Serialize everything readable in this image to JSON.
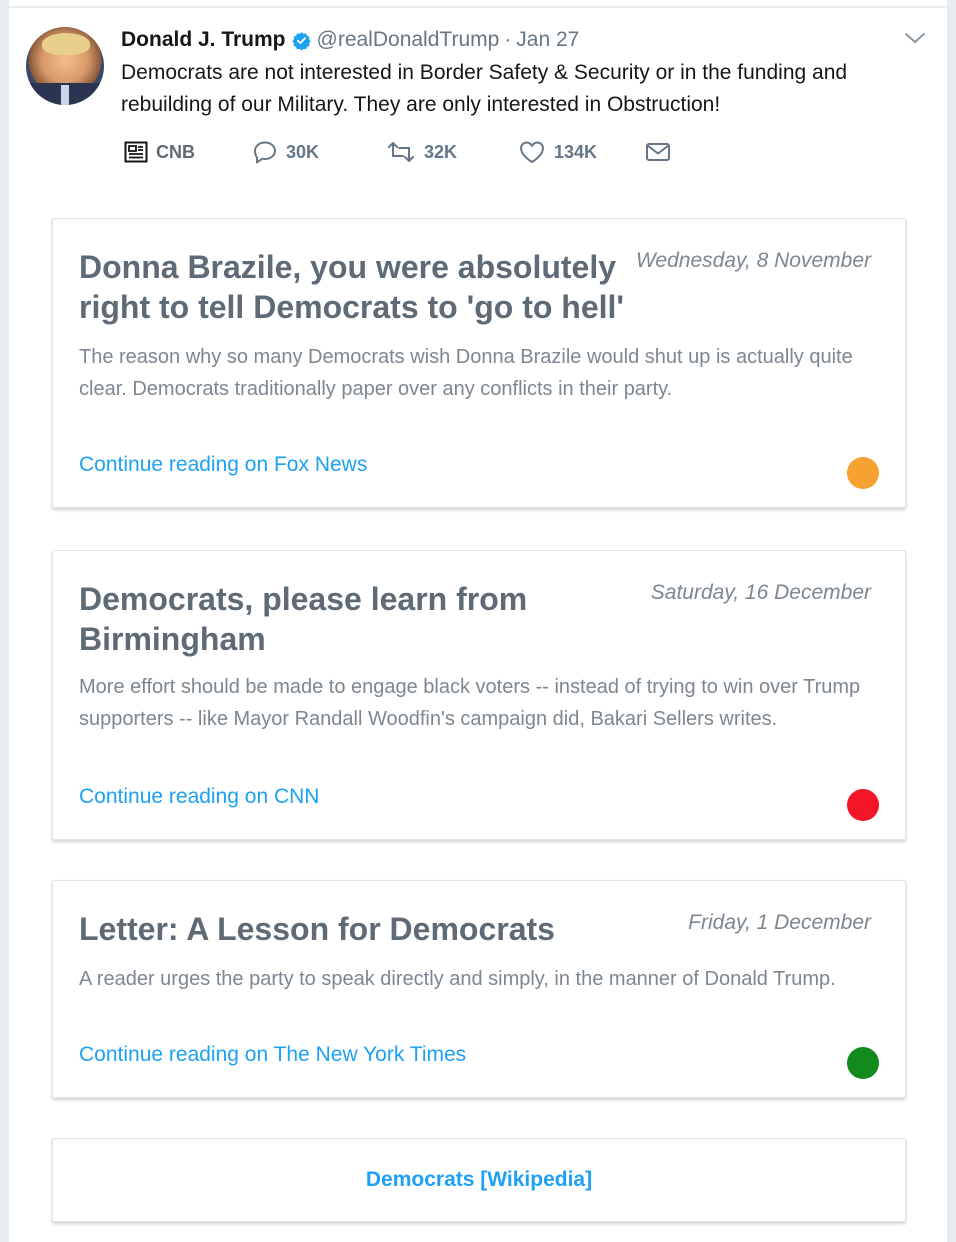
{
  "tweet": {
    "name": "Donald J. Trump",
    "handle": "@realDonaldTrump",
    "separator": "·",
    "date": "Jan 27",
    "text": "Democrats are not interested in Border Safety & Security or in the funding and rebuilding of our Military. They are only interested in Obstruction!",
    "avatar_icon": "profile-photo",
    "verified_icon": "verified-badge-icon",
    "actions": {
      "source_label": "CNB",
      "reply_count": "30K",
      "retweet_count": "32K",
      "like_count": "134K"
    }
  },
  "cards": [
    {
      "title": "Donna Brazile, you were absolutely right to tell Democrats to 'go to hell'",
      "date": "Wednesday, 8 November",
      "description": "The reason why so many Democrats wish Donna Brazile would shut up is actually quite clear. Democrats traditionally paper over any conflicts in their party.",
      "link": "Continue reading on Fox News",
      "dot_color": "#f7a130"
    },
    {
      "title": "Democrats, please learn from Birmingham",
      "date": "Saturday, 16 December",
      "description": "More effort should be made to engage black voters -- instead of trying to win over Trump supporters -- like Mayor Randall Woodfin's campaign did, Bakari Sellers writes.",
      "link": "Continue reading on CNN",
      "dot_color": "#f31427"
    },
    {
      "title": "Letter: A Lesson for Democrats",
      "date": "Friday, 1 December",
      "description": "A reader urges the party to speak directly and simply, in the manner of Donald Trump.",
      "link": "Continue reading on The New York Times",
      "dot_color": "#138a1c"
    }
  ],
  "wiki_link": "Democrats [Wikipedia]",
  "colors": {
    "link": "#1da1f2",
    "muted": "#657786",
    "title": "#5e6a75"
  }
}
